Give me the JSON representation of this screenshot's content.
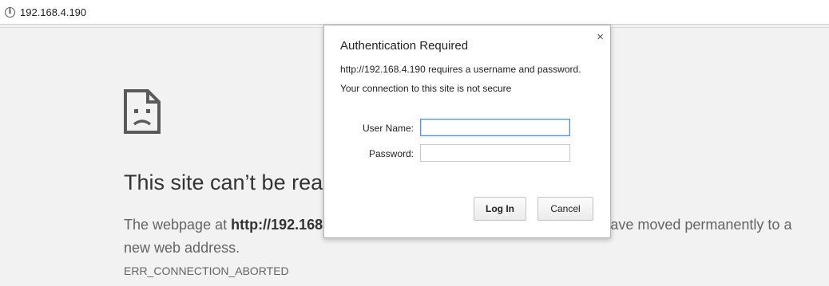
{
  "address_bar": {
    "url": "192.168.4.190",
    "info_icon_glyph": "i"
  },
  "error_page": {
    "title": "This site can’t be reached",
    "desc_prefix": "The webpage at ",
    "desc_url": "http://192.168.4.190/",
    "desc_suffix": " might be temporarily down or it may have moved permanently to a new web address.",
    "error_code": "ERR_CONNECTION_ABORTED"
  },
  "dialog": {
    "title": "Authentication Required",
    "message": "http://192.168.4.190 requires a username and password.",
    "security_note": "Your connection to this site is not secure",
    "close_glyph": "×",
    "username_label": "User Name:",
    "username_value": "",
    "password_label": "Password:",
    "password_value": "",
    "login_label": "Log In",
    "cancel_label": "Cancel"
  },
  "colors": {
    "page_background": "#f2f2f2",
    "focus_border": "#4d90fe"
  }
}
